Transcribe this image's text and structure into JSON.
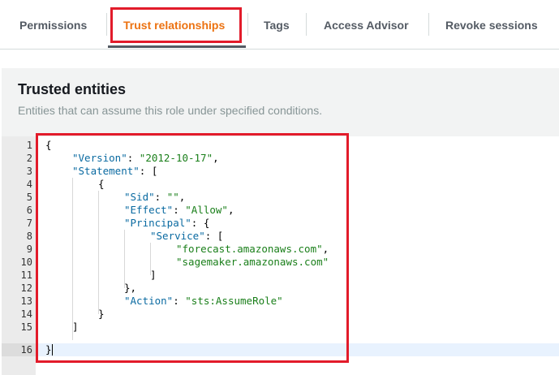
{
  "tabs": [
    {
      "label": "Permissions"
    },
    {
      "label": "Trust relationships"
    },
    {
      "label": "Tags"
    },
    {
      "label": "Access Advisor"
    },
    {
      "label": "Revoke sessions"
    }
  ],
  "active_tab": "Trust relationships",
  "section": {
    "title": "Trusted entities",
    "subtitle": "Entities that can assume this role under specified conditions."
  },
  "editor": {
    "line_numbers": [
      "1",
      "2",
      "3",
      "4",
      "5",
      "6",
      "7",
      "8",
      "9",
      "10",
      "11",
      "12",
      "13",
      "14",
      "15",
      "16"
    ],
    "current_line": "16",
    "tokens": {
      "l1_brace": "{",
      "l2_key": "\"Version\"",
      "l2_sep": ": ",
      "l2_val": "\"2012-10-17\"",
      "l2_end": ",",
      "l3_key": "\"Statement\"",
      "l3_rest": ": [",
      "l4": "{",
      "l5_key": "\"Sid\"",
      "l5_sep": ": ",
      "l5_val": "\"\"",
      "l5_end": ",",
      "l6_key": "\"Effect\"",
      "l6_sep": ": ",
      "l6_val": "\"Allow\"",
      "l6_end": ",",
      "l7_key": "\"Principal\"",
      "l7_rest": ": {",
      "l8_key": "\"Service\"",
      "l8_rest": ": [",
      "l9_val": "\"forecast.amazonaws.com\"",
      "l9_end": ",",
      "l10_val": "\"sagemaker.amazonaws.com\"",
      "l11": "]",
      "l12": "},",
      "l13_key": "\"Action\"",
      "l13_sep": ": ",
      "l13_val": "\"sts:AssumeRole\"",
      "l14": "}",
      "l15": "]",
      "l16": "}"
    }
  },
  "colors": {
    "accent": "#ec7211",
    "highlight_box": "#e21b2a",
    "json_key": "#0a6aa1",
    "json_string": "#1a7f1a"
  }
}
